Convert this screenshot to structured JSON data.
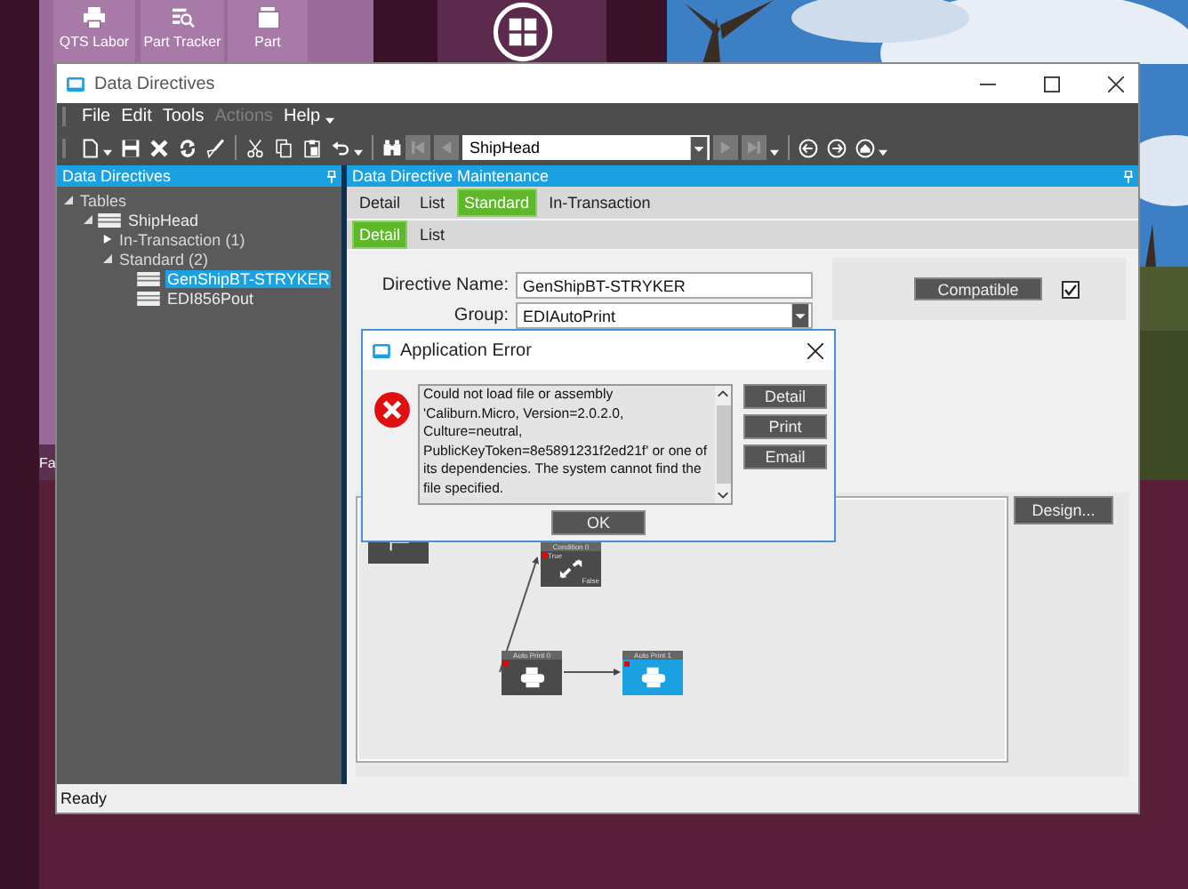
{
  "desktop": {
    "tiles": [
      {
        "label": "QTS Labor"
      },
      {
        "label": "Part Tracker"
      },
      {
        "label": "Part"
      },
      {
        "label": "Fa"
      }
    ]
  },
  "window": {
    "title": "Data Directives"
  },
  "menu": [
    {
      "label": "File",
      "disabled": false
    },
    {
      "label": "Edit",
      "disabled": false
    },
    {
      "label": "Tools",
      "disabled": false
    },
    {
      "label": "Actions",
      "disabled": true
    },
    {
      "label": "Help",
      "disabled": false
    }
  ],
  "toolbar": {
    "record": "ShipHead"
  },
  "tree": {
    "title": "Data Directives",
    "items": [
      {
        "label": "Tables",
        "kind": "group",
        "expanded": true,
        "children": [
          {
            "label": "ShipHead",
            "kind": "table",
            "expanded": true,
            "children": [
              {
                "label": "In-Transaction (1)",
                "kind": "group",
                "expanded": false
              },
              {
                "label": "Standard (2)",
                "kind": "group",
                "expanded": true,
                "children": [
                  {
                    "label": "GenShipBT-STRYKER",
                    "kind": "table",
                    "selected": true
                  },
                  {
                    "label": "EDI856Pout",
                    "kind": "table",
                    "selected": false
                  }
                ]
              }
            ]
          }
        ]
      }
    ]
  },
  "maintenance": {
    "title": "Data Directive Maintenance",
    "tabs": [
      {
        "label": "Detail",
        "selected": false
      },
      {
        "label": "List",
        "selected": false
      },
      {
        "label": "Standard",
        "selected": true
      },
      {
        "label": "In-Transaction",
        "selected": false
      }
    ],
    "subtabs": [
      {
        "label": "Detail",
        "selected": true
      },
      {
        "label": "List",
        "selected": false
      }
    ],
    "directive_name_label": "Directive Name:",
    "directive_name": "GenShipBT-STRYKER",
    "group_label": "Group:",
    "group": "EDIAutoPrint",
    "compatible_button": "Compatible",
    "compatible_checked": true,
    "design_button": "Design...",
    "diagram": {
      "nodes": [
        {
          "kind": "start",
          "selected": false
        },
        {
          "kind": "condition",
          "title": "Condition 0",
          "true_label": "True",
          "false_label": "False",
          "selected": false
        },
        {
          "kind": "print",
          "title": "Auto Print 0",
          "selected": false
        },
        {
          "kind": "print",
          "title": "Auto Print 1",
          "selected": true
        }
      ]
    }
  },
  "status_bar": "Ready",
  "dialog": {
    "title": "Application Error",
    "message": "Could not load file or assembly 'Caliburn.Micro, Version=2.0.2.0, Culture=neutral, PublicKeyToken=8e5891231f2ed21f' or one of its dependencies. The system cannot find the file specified.",
    "buttons": [
      "Detail",
      "Print",
      "Email"
    ],
    "ok": "OK"
  }
}
